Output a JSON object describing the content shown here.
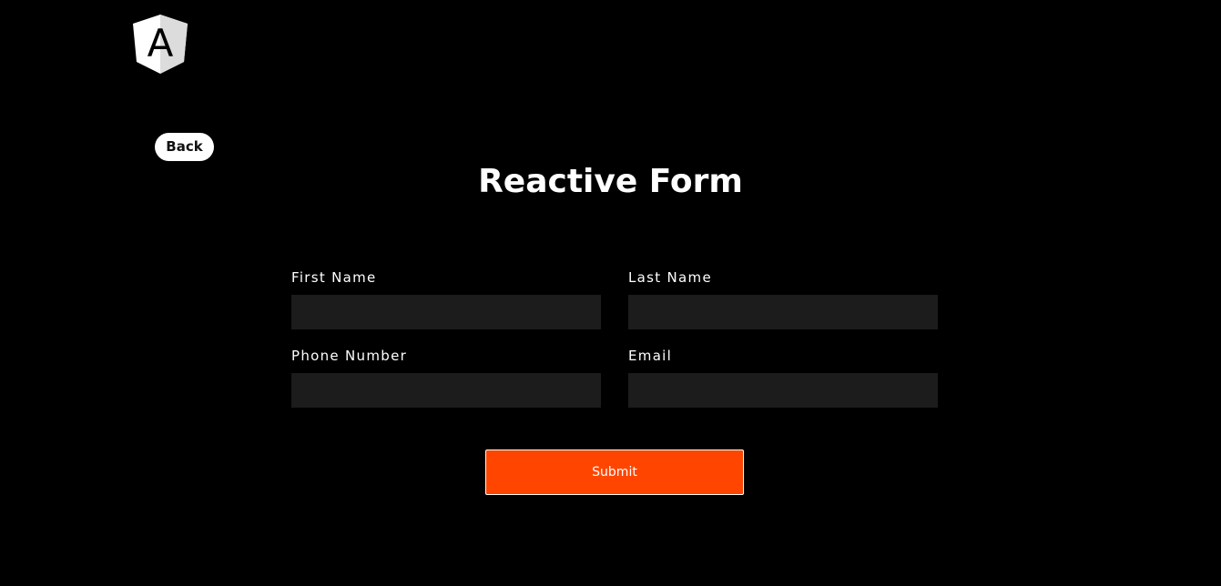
{
  "header": {
    "logo_icon": "angular-shield-logo-icon",
    "logo_letter": "A"
  },
  "back_label": "Back",
  "title": "Reactive Form",
  "form": {
    "fields": [
      {
        "label": "First Name",
        "value": "",
        "placeholder": ""
      },
      {
        "label": "Last Name",
        "value": "",
        "placeholder": ""
      },
      {
        "label": "Phone Number",
        "value": "",
        "placeholder": ""
      },
      {
        "label": "Email",
        "value": "",
        "placeholder": ""
      }
    ],
    "submit_label": "Submit"
  },
  "colors": {
    "background": "#000000",
    "input_background": "#1c1c1c",
    "accent": "#ff4500",
    "text": "#ffffff"
  }
}
